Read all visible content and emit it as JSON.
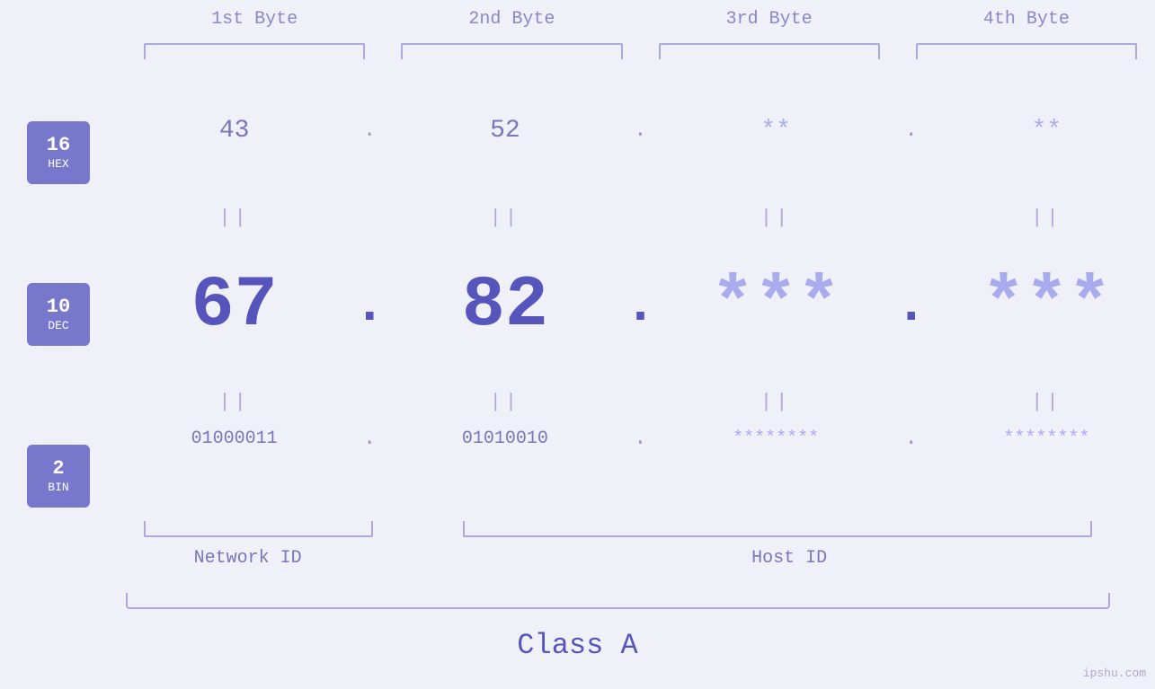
{
  "headers": {
    "col1": "1st Byte",
    "col2": "2nd Byte",
    "col3": "3rd Byte",
    "col4": "4th Byte"
  },
  "badges": {
    "hex": {
      "num": "16",
      "label": "HEX"
    },
    "dec": {
      "num": "10",
      "label": "DEC"
    },
    "bin": {
      "num": "2",
      "label": "BIN"
    }
  },
  "hex_row": {
    "b1": "43",
    "b2": "52",
    "b3": "**",
    "b4": "**",
    "dots": [
      ".",
      ".",
      "."
    ]
  },
  "dec_row": {
    "b1": "67",
    "b2": "82",
    "b3": "***",
    "b4": "***",
    "dots": [
      ".",
      ".",
      "."
    ]
  },
  "bin_row": {
    "b1": "01000011",
    "b2": "01010010",
    "b3": "********",
    "b4": "********",
    "dots": [
      ".",
      ".",
      "."
    ]
  },
  "labels": {
    "network_id": "Network ID",
    "host_id": "Host ID",
    "class": "Class A"
  },
  "watermark": "ipshu.com"
}
